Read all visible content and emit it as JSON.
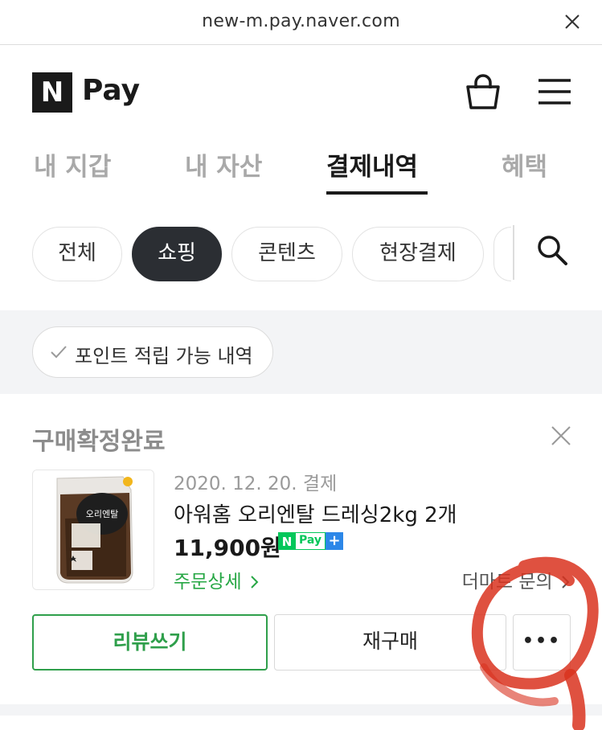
{
  "browser": {
    "url": "new-m.pay.naver.com"
  },
  "header": {
    "logo_letter": "N",
    "logo_text": "Pay"
  },
  "tabs": [
    {
      "label": "내 지갑"
    },
    {
      "label": "내 자산"
    },
    {
      "label": "결제내역"
    },
    {
      "label": "혜택"
    }
  ],
  "active_tab": "결제내역",
  "chips": [
    {
      "label": "전체"
    },
    {
      "label": "쇼핑"
    },
    {
      "label": "콘텐츠"
    },
    {
      "label": "현장결제"
    }
  ],
  "active_chip": "쇼핑",
  "filter": {
    "point_label": "포인트 적립 가능 내역"
  },
  "order": {
    "status": "구매확정완료",
    "date": "2020. 12. 20. 결제",
    "product_name": "아워홈 오리엔탈 드레싱2kg 2개",
    "price": "11,900원",
    "npay_badge": {
      "n": "N",
      "pay": "Pay",
      "plus": "+"
    },
    "order_detail_link": "주문상세",
    "store_inquiry_link": "더마트 문의",
    "product_image_text": "오리엔탈",
    "buttons": {
      "review": "리뷰쓰기",
      "reorder": "재구매",
      "more": "•••"
    }
  },
  "colors": {
    "brand_dark": "#1a1a1a",
    "naver_green": "#03c75a",
    "review_green": "#2f9f4b",
    "link_green": "#27a745",
    "annotation_red": "#d9321f"
  }
}
